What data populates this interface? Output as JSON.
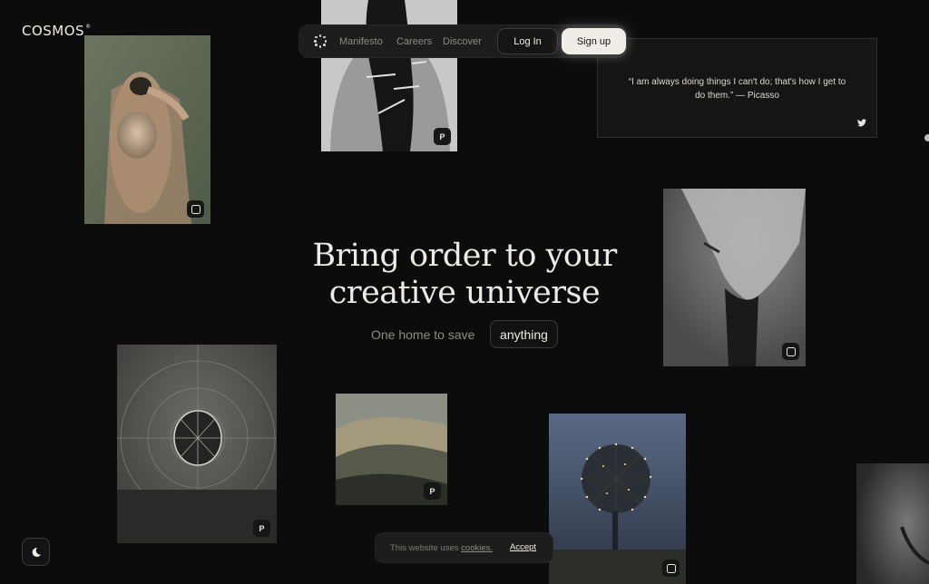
{
  "brand": {
    "name": "COSMOS",
    "mark": "®"
  },
  "nav": {
    "links": [
      "Manifesto",
      "Careers",
      "Discover"
    ],
    "login": "Log In",
    "signup": "Sign up"
  },
  "quote": {
    "text": "“I am always doing things I can't do; that's how I get to do them.” — Picasso",
    "source_icon": "twitter-icon"
  },
  "hero": {
    "title_line1": "Bring order to your",
    "title_line2": "creative universe",
    "subtitle": "One home to save",
    "chip": "anything"
  },
  "cookie": {
    "text": "This website uses",
    "link": "cookies.",
    "accept": "Accept"
  },
  "photos": [
    {
      "source_icon": "instagram-icon"
    },
    {
      "source_icon": "pinterest-icon"
    },
    {
      "source_icon": "instagram-icon"
    },
    {
      "source_icon": "pinterest-icon"
    },
    {
      "source_icon": "pinterest-icon"
    },
    {
      "source_icon": "instagram-icon"
    }
  ],
  "colors": {
    "background": "#0c0c0c",
    "accent": "#efede6"
  },
  "theme_toggle_icon": "moon-icon"
}
